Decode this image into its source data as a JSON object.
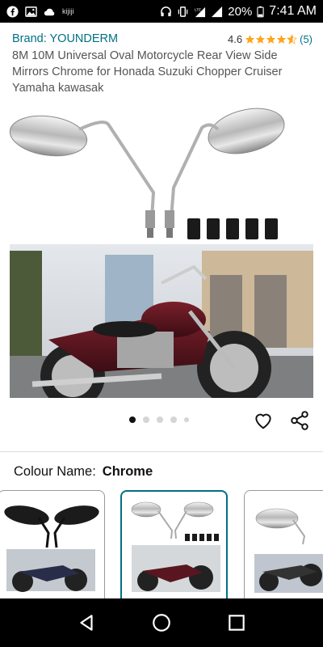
{
  "status_bar": {
    "apps": [
      "facebook-icon",
      "image-icon",
      "cloud-icon"
    ],
    "kijiji_label": "kijiji",
    "battery": "20%",
    "time": "7:41 AM"
  },
  "product": {
    "brand": "Brand: YOUNDERM",
    "rating_value": "4.6",
    "rating_count": "(5)",
    "title": "8M 10M Universal Oval Motorcycle Rear View Side Mirrors Chrome for Honada Suzuki Chopper Cruiser Yamaha kawasak",
    "image_count": 5,
    "active_image": 1
  },
  "colour": {
    "label": "Colour Name:",
    "selected": "Chrome"
  },
  "swatches": [
    "Black",
    "Chrome",
    "Chrome-2"
  ],
  "colors": {
    "link": "#007185",
    "star": "#ffa41c",
    "selected_border": "#007185"
  }
}
